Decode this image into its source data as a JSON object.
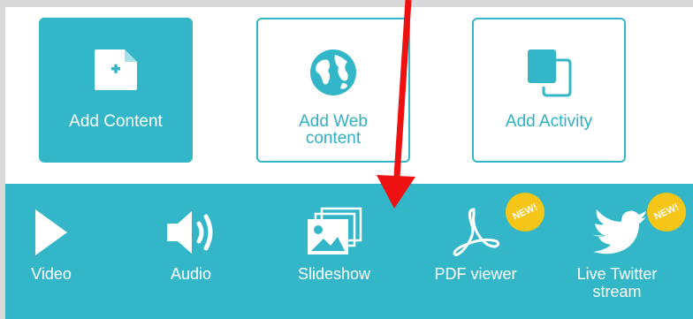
{
  "tiles": [
    {
      "label": "Add Content",
      "icon": "add-file-icon"
    },
    {
      "label": "Add Web\ncontent",
      "icon": "globe-icon"
    },
    {
      "label": "Add Activity",
      "icon": "copy-pages-icon"
    }
  ],
  "media": [
    {
      "label": "Video",
      "icon": "play-icon"
    },
    {
      "label": "Audio",
      "icon": "speaker-icon"
    },
    {
      "label": "Slideshow",
      "icon": "images-stack-icon"
    },
    {
      "label": "PDF viewer",
      "icon": "pdf-icon",
      "badge": "NEW!"
    },
    {
      "label": "Live Twitter\nstream",
      "icon": "bird-icon",
      "badge": "NEW!"
    }
  ],
  "colors": {
    "accent": "#33b7c8",
    "badge": "#f5c518",
    "arrow": "#ee1111",
    "background": "#ffffff",
    "outer": "#d9d9d9"
  }
}
